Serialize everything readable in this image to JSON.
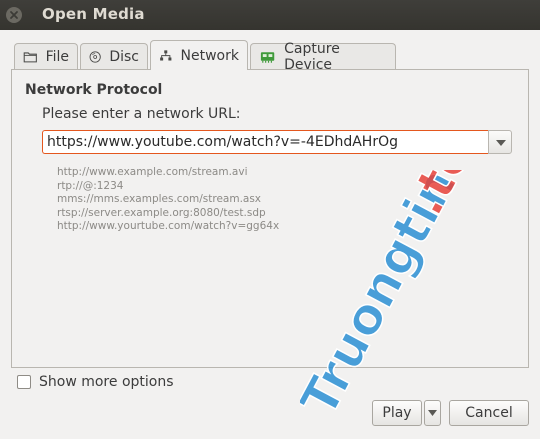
{
  "window": {
    "title": "Open Media"
  },
  "tabs": [
    {
      "label": "File",
      "icon": "folder-icon"
    },
    {
      "label": "Disc",
      "icon": "disc-icon"
    },
    {
      "label": "Network",
      "icon": "network-icon"
    },
    {
      "label": "Capture Device",
      "icon": "capture-card-icon"
    }
  ],
  "network": {
    "group_title": "Network Protocol",
    "prompt": "Please enter a network URL:",
    "url_value": "https://www.youtube.com/watch?v=-4EDhdAHrOg",
    "examples": [
      "http://www.example.com/stream.avi",
      "rtp://@:1234",
      "mms://mms.examples.com/stream.asx",
      "rtsp://server.example.org:8080/test.sdp",
      "http://www.yourtube.com/watch?v=gg64x"
    ]
  },
  "options": {
    "show_more_label": "Show more options",
    "show_more_checked": false
  },
  "buttons": {
    "play": "Play",
    "cancel": "Cancel"
  },
  "watermark": {
    "text_main": "Truongtin",
    "text_suffix": ".top"
  },
  "colors": {
    "focus_border": "#e4571e",
    "titlebar": "#3c3b37",
    "watermark_blue": "#2b8fd4",
    "watermark_red": "#e8423a"
  }
}
